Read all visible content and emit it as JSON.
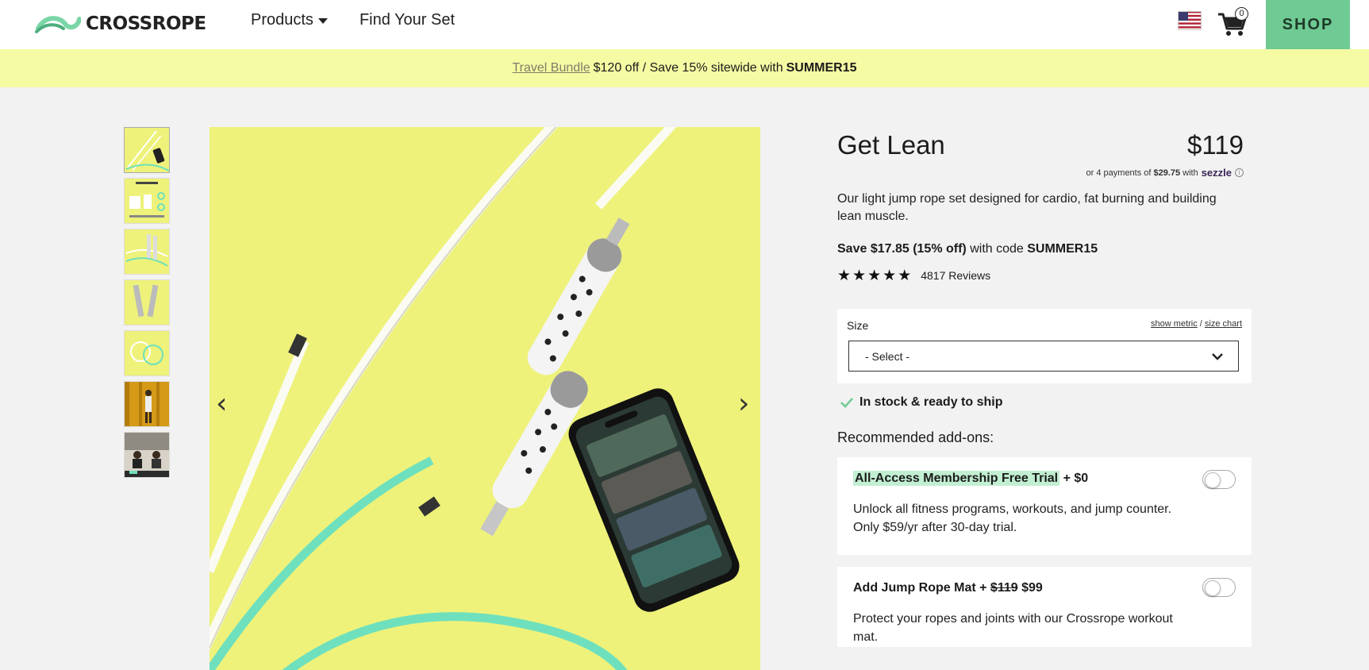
{
  "header": {
    "logo_text": "CROSSROPE",
    "nav": [
      {
        "label": "Products",
        "has_dropdown": true
      },
      {
        "label": "Find Your Set",
        "has_dropdown": false
      }
    ],
    "cart_count": "0",
    "shop_label": "SHOP"
  },
  "promo": {
    "link_text": "Travel Bundle",
    "text": "$120 off / Save 15% sitewide with",
    "code": "SUMMER15"
  },
  "gallery": {
    "thumbnail_count": 7
  },
  "product": {
    "title": "Get Lean",
    "price": "$119",
    "sezzle_prefix": "or 4 payments of",
    "sezzle_amount": "$29.75",
    "sezzle_with": "with",
    "sezzle_brand": "sezzle",
    "description": "Our light jump rope set designed for cardio, fat burning and building lean muscle.",
    "save_bold": "Save $17.85 (15% off)",
    "save_text": "with code",
    "save_code": "SUMMER15",
    "rating_stars": 5,
    "reviews": "4817 Reviews"
  },
  "size": {
    "label": "Size",
    "show_metric": "show metric",
    "separator": "/",
    "size_chart": "size chart",
    "selected": "- Select -"
  },
  "stock": "In stock & ready to ship",
  "addons": {
    "title": "Recommended add-ons:",
    "items": [
      {
        "name": "All-Access Membership Free Trial",
        "price_text": "+ $0",
        "description": "Unlock all fitness programs, workouts, and jump counter. Only $59/yr after 30-day trial.",
        "enabled": false
      },
      {
        "name": "Add Jump Rope Mat",
        "plus": "+",
        "old_price": "$119",
        "new_price": "$99",
        "description": "Protect your ropes and joints with our Crossrope workout mat.",
        "enabled": false
      }
    ]
  },
  "colors": {
    "shop_green": "#6fcb93",
    "promo_yellow": "#f5fba3",
    "product_bg_yellow": "#eef27a",
    "rope_mint": "#6fe0bd",
    "highlight_mint": "#c2efd2"
  }
}
